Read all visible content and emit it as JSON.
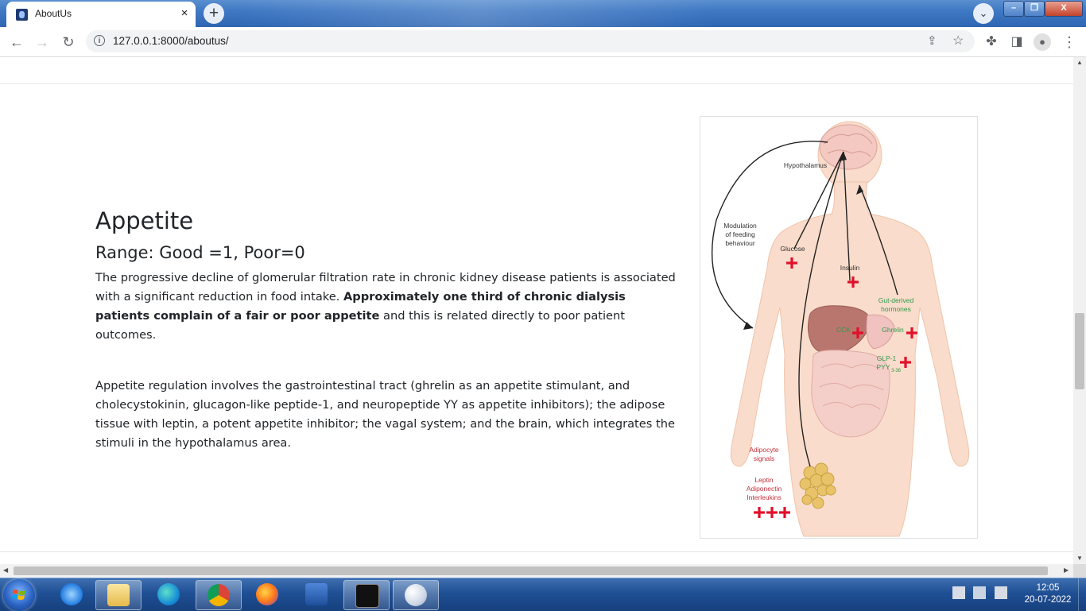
{
  "browser": {
    "tab_title": "AboutUs",
    "tab_close": "×",
    "new_tab": "+",
    "url": "127.0.0.1:8000/aboutus/"
  },
  "page": {
    "heading": "Appetite",
    "subheading": "Range: Good =1, Poor=0",
    "paragraph1_start": "The progressive decline of glomerular filtration rate in chronic kidney disease patients is associated with a significant reduction in food intake. ",
    "paragraph1_bold": "Approximately one third of chronic dialysis patients complain of a fair or poor appetite",
    "paragraph1_end": " and this is related directly to poor patient outcomes.",
    "paragraph2": "Appetite regulation involves the gastrointestinal tract (ghrelin as an appetite stimulant, and cholecystokinin, glucagon-like peptide-1, and neuropeptide YY as appetite inhibitors); the adipose tissue with leptin, a potent appetite inhibitor; the vagal system; and the brain, which integrates the stimuli in the hypothalamus area."
  },
  "figure": {
    "labels": {
      "hypothalamus": "Hypothalamus",
      "modulation1": "Modulation",
      "modulation2": "of feeding",
      "modulation3": "behaviour",
      "glucose": "Glucose",
      "insulin": "Insulin",
      "gut1": "Gut-derived",
      "gut2": "hormones",
      "cck": "CCK",
      "ghrelin": "Ghrelin",
      "glp1": "GLP-1",
      "pyy": "PYY",
      "pyy_sub": "3-36",
      "adipocyte1": "Adipocyte",
      "adipocyte2": "signals",
      "leptin": "Leptin",
      "adiponectin": "Adiponectin",
      "interleukins": "Interleukins"
    },
    "colors": {
      "green": "#2f9a4a",
      "red": "#e0102a",
      "dark_red": "#c4303c",
      "skin": "#f8d9c6"
    }
  },
  "taskbar": {
    "time": "12:05",
    "date": "20-07-2022"
  }
}
